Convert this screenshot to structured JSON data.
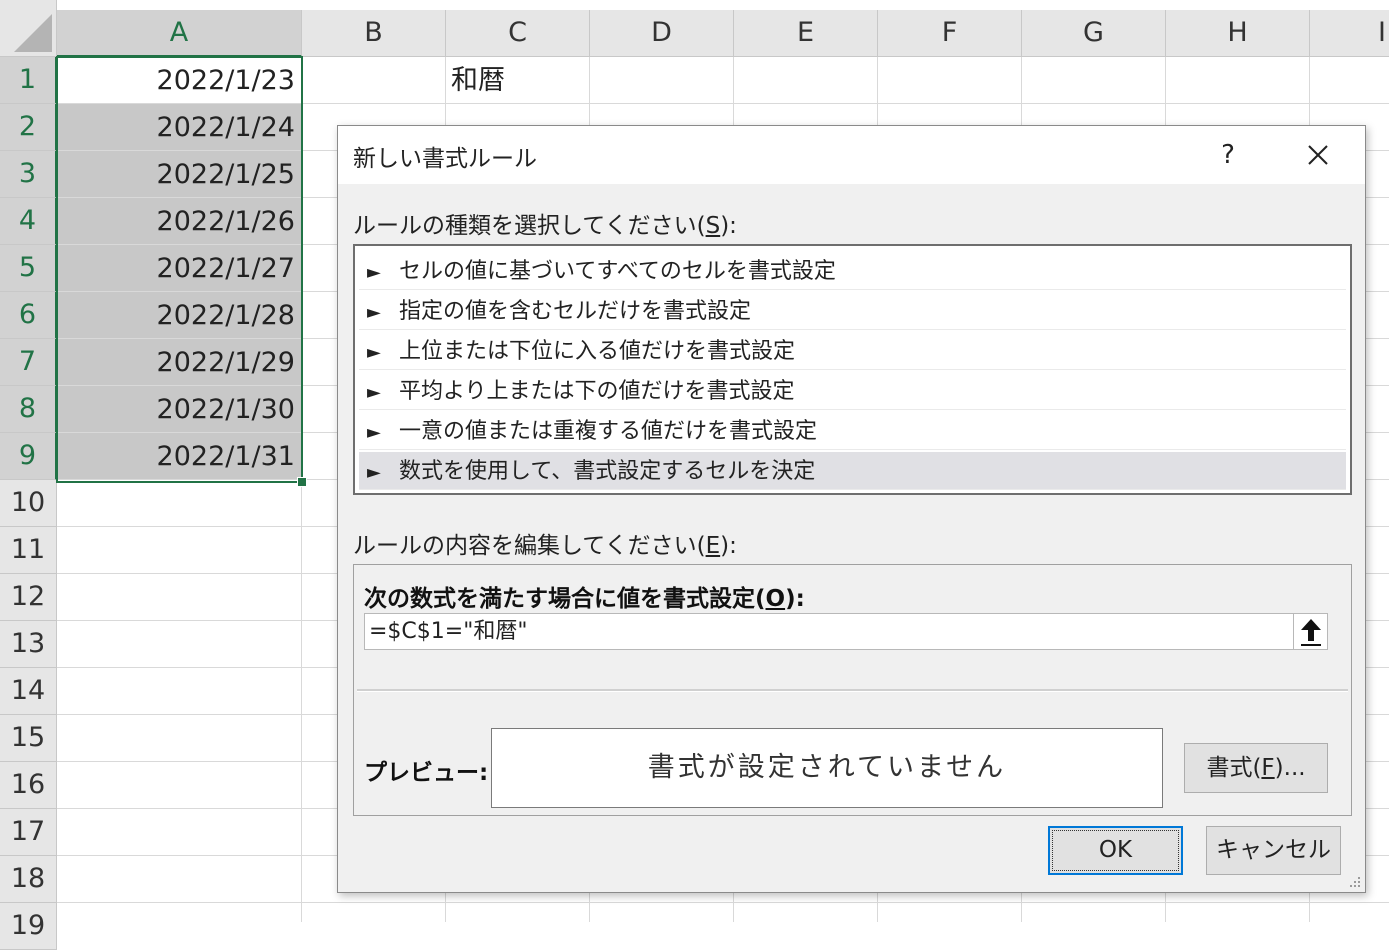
{
  "sheet": {
    "columns": [
      "A",
      "B",
      "C",
      "D",
      "E",
      "F",
      "G",
      "H",
      "I"
    ],
    "rows": [
      "1",
      "2",
      "3",
      "4",
      "5",
      "6",
      "7",
      "8",
      "9",
      "10",
      "11",
      "12",
      "13",
      "14",
      "15",
      "16",
      "17",
      "18",
      "19"
    ],
    "colA": [
      "2022/1/23",
      "2022/1/24",
      "2022/1/25",
      "2022/1/26",
      "2022/1/27",
      "2022/1/28",
      "2022/1/29",
      "2022/1/30",
      "2022/1/31"
    ],
    "c1": "和暦",
    "accent": "#217346"
  },
  "dialog": {
    "title": "新しい書式ルール",
    "help": "?",
    "select_label_pre": "ルールの種類を選択してください(",
    "select_label_key": "S",
    "select_label_post": "):",
    "arrow": "►",
    "rule_types": [
      "セルの値に基づいてすべてのセルを書式設定",
      "指定の値を含むセルだけを書式設定",
      "上位または下位に入る値だけを書式設定",
      "平均より上または下の値だけを書式設定",
      "一意の値または重複する値だけを書式設定",
      "数式を使用して、書式設定するセルを決定"
    ],
    "selected_rule_index": 5,
    "edit_label_pre": "ルールの内容を編集してください(",
    "edit_label_key": "E",
    "edit_label_post": "):",
    "formula_label_pre": "次の数式を満たす場合に値を書式設定(",
    "formula_label_key": "O",
    "formula_label_post": "):",
    "formula_value": "=$C$1=\"和暦\"",
    "preview_label": "プレビュー:",
    "preview_text": "書式が設定されていません",
    "format_pre": "書式(",
    "format_key": "F",
    "format_post": ")...",
    "ok": "OK",
    "cancel": "キャンセル",
    "focus_color": "#0078d7"
  }
}
